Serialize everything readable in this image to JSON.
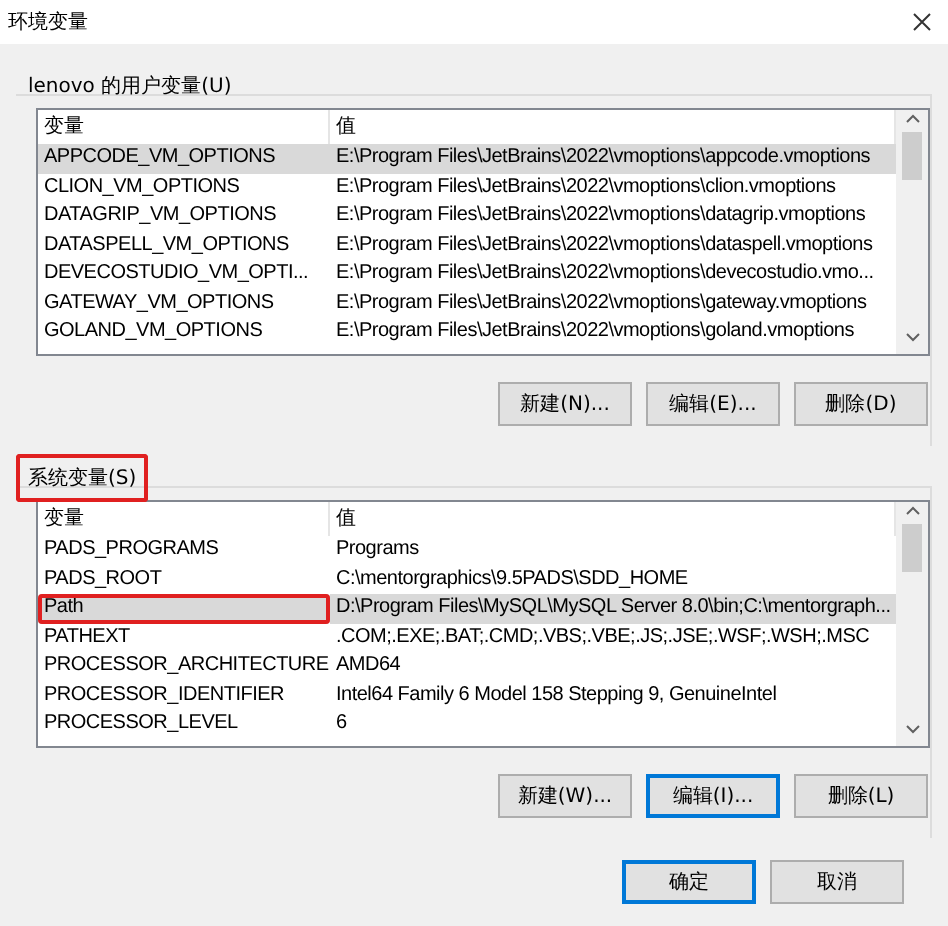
{
  "window": {
    "title": "环境变量"
  },
  "user_variables": {
    "label": "lenovo 的用户变量(U)",
    "annotated": false,
    "columns": [
      "变量",
      "值"
    ],
    "rows": [
      {
        "name": "APPCODE_VM_OPTIONS",
        "value": "E:\\Program Files\\JetBrains\\2022\\vmoptions\\appcode.vmoptions",
        "selected": true,
        "annotated": false
      },
      {
        "name": "CLION_VM_OPTIONS",
        "value": "E:\\Program Files\\JetBrains\\2022\\vmoptions\\clion.vmoptions",
        "selected": false,
        "annotated": false
      },
      {
        "name": "DATAGRIP_VM_OPTIONS",
        "value": "E:\\Program Files\\JetBrains\\2022\\vmoptions\\datagrip.vmoptions",
        "selected": false,
        "annotated": false
      },
      {
        "name": "DATASPELL_VM_OPTIONS",
        "value": "E:\\Program Files\\JetBrains\\2022\\vmoptions\\dataspell.vmoptions",
        "selected": false,
        "annotated": false
      },
      {
        "name": "DEVECOSTUDIO_VM_OPTI...",
        "value": "E:\\Program Files\\JetBrains\\2022\\vmoptions\\devecostudio.vmo...",
        "selected": false,
        "annotated": false
      },
      {
        "name": "GATEWAY_VM_OPTIONS",
        "value": "E:\\Program Files\\JetBrains\\2022\\vmoptions\\gateway.vmoptions",
        "selected": false,
        "annotated": false
      },
      {
        "name": "GOLAND_VM_OPTIONS",
        "value": "E:\\Program Files\\JetBrains\\2022\\vmoptions\\goland.vmoptions",
        "selected": false,
        "annotated": false
      }
    ],
    "buttons": [
      {
        "label": "新建(N)...",
        "default": false
      },
      {
        "label": "编辑(E)...",
        "default": false
      },
      {
        "label": "删除(D)",
        "default": false
      }
    ]
  },
  "system_variables": {
    "label": "系统变量(S)",
    "annotated": true,
    "columns": [
      "变量",
      "值"
    ],
    "rows": [
      {
        "name": "PADS_PROGRAMS",
        "value": "Programs",
        "selected": false,
        "annotated": false
      },
      {
        "name": "PADS_ROOT",
        "value": "C:\\mentorgraphics\\9.5PADS\\SDD_HOME",
        "selected": false,
        "annotated": false
      },
      {
        "name": "Path",
        "value": "D:\\Program Files\\MySQL\\MySQL Server 8.0\\bin;C:\\mentorgraph...",
        "selected": true,
        "annotated": true
      },
      {
        "name": "PATHEXT",
        "value": ".COM;.EXE;.BAT;.CMD;.VBS;.VBE;.JS;.JSE;.WSF;.WSH;.MSC",
        "selected": false,
        "annotated": false
      },
      {
        "name": "PROCESSOR_ARCHITECTURE",
        "value": "AMD64",
        "selected": false,
        "annotated": false
      },
      {
        "name": "PROCESSOR_IDENTIFIER",
        "value": "Intel64 Family 6 Model 158 Stepping 9, GenuineIntel",
        "selected": false,
        "annotated": false
      },
      {
        "name": "PROCESSOR_LEVEL",
        "value": "6",
        "selected": false,
        "annotated": false
      }
    ],
    "buttons": [
      {
        "label": "新建(W)...",
        "default": false
      },
      {
        "label": "编辑(I)...",
        "default": true
      },
      {
        "label": "删除(L)",
        "default": false
      }
    ]
  },
  "footer_buttons": [
    {
      "label": "确定",
      "default": true
    },
    {
      "label": "取消",
      "default": false
    }
  ]
}
